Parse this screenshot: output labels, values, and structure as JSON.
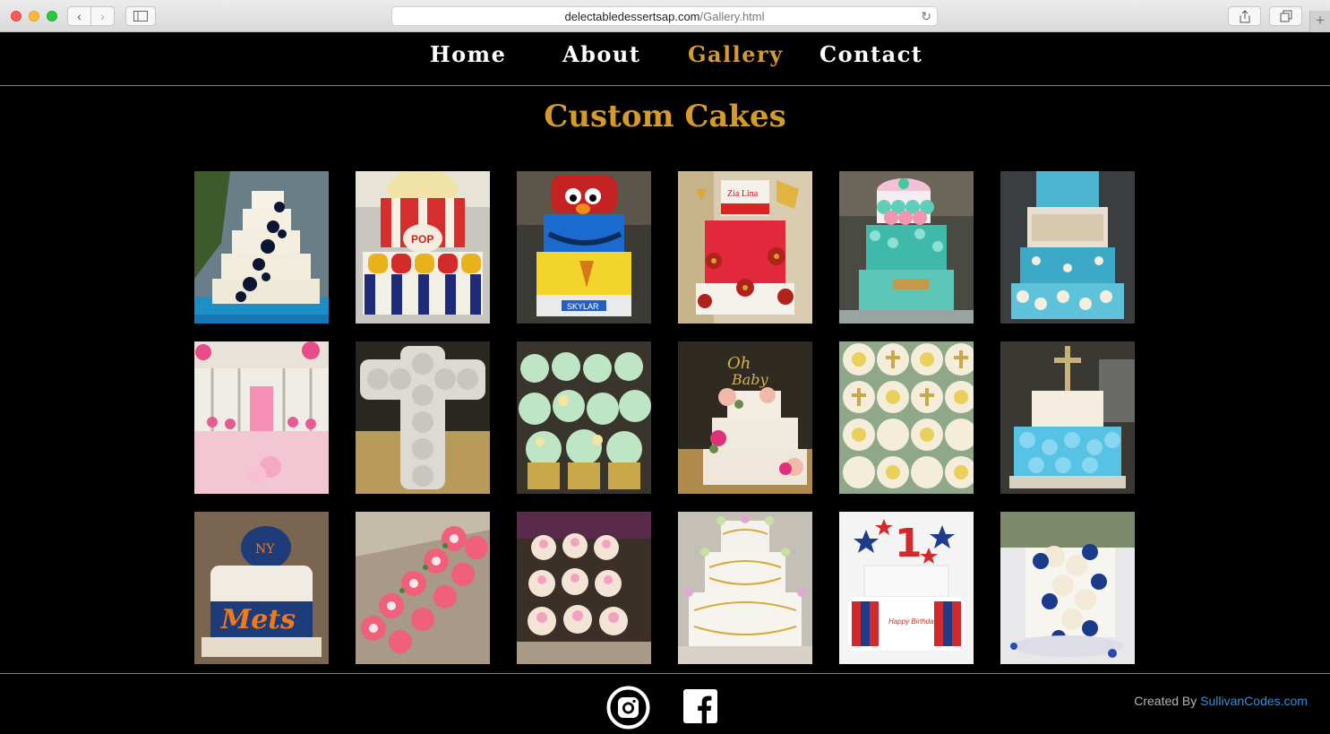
{
  "browser": {
    "url_domain": "delectabledessertsap.com",
    "url_path": "/Gallery.html"
  },
  "nav": {
    "items": [
      {
        "label": "Home"
      },
      {
        "label": "About"
      },
      {
        "label": "Gallery"
      },
      {
        "label": "Contact"
      }
    ],
    "active": "Gallery",
    "accent_color": "#d49a2a"
  },
  "page": {
    "title": "Custom Cakes"
  },
  "gallery": {
    "items": [
      {
        "icon": "tiered-cake-navy-flowers"
      },
      {
        "icon": "popcorn-cake"
      },
      {
        "icon": "elmo-cookie-monster-big-bird-cake"
      },
      {
        "icon": "red-gold-poinsettia-cake"
      },
      {
        "icon": "mermaid-scales-cake"
      },
      {
        "icon": "frozen-teal-cake"
      },
      {
        "icon": "pink-party-table"
      },
      {
        "icon": "cupcake-cross"
      },
      {
        "icon": "mint-green-cupcakes"
      },
      {
        "icon": "oh-baby-floral-cake"
      },
      {
        "icon": "cross-topped-cupcakes"
      },
      {
        "icon": "blue-rosette-cross-cake"
      },
      {
        "icon": "mets-baseball-cake"
      },
      {
        "icon": "pink-rose-cupcakes"
      },
      {
        "icon": "pink-flower-cupcakes"
      },
      {
        "icon": "gold-scroll-tiered-cake"
      },
      {
        "icon": "first-birthday-stars-cake"
      },
      {
        "icon": "blue-white-roses-cake"
      }
    ]
  },
  "footer": {
    "credit_prefix": "Created By ",
    "credit_link": "SullivanCodes.com",
    "social": [
      {
        "icon": "instagram-icon"
      },
      {
        "icon": "facebook-icon"
      }
    ]
  }
}
